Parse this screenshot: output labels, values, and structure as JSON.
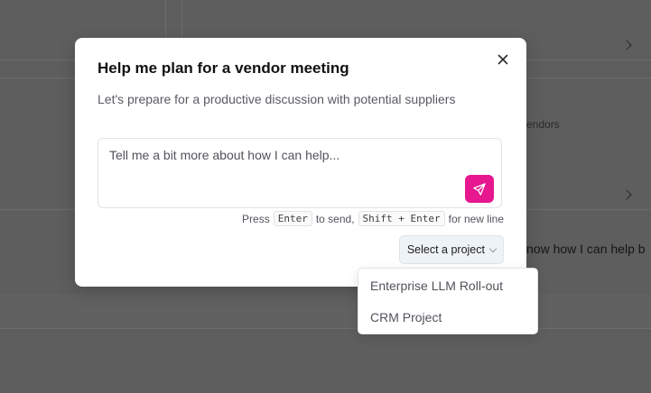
{
  "background": {
    "vendors_fragment": "endors",
    "help_fragment": "now how I can help b"
  },
  "modal": {
    "title": "Help me plan for a vendor meeting",
    "subtitle": "Let's prepare for a productive discussion with potential suppliers",
    "close_icon": "close-icon",
    "prompt": {
      "value": "",
      "placeholder": "Tell me a bit more about how I can help..."
    },
    "send_icon": "paper-plane-icon",
    "hint": {
      "press": "Press",
      "enter_key": "Enter",
      "to_send": "to send,",
      "shift_enter_key": "Shift + Enter",
      "for_new_line": "for new line"
    },
    "project_select": {
      "label": "Select a project",
      "icon": "chevron-down-icon"
    }
  },
  "dropdown": {
    "options": [
      {
        "label": "Enterprise LLM Roll-out"
      },
      {
        "label": "CRM Project"
      }
    ]
  },
  "colors": {
    "accent": "#e6178f",
    "overlay": "#5e5e5e",
    "select_bg": "#eef3f7"
  }
}
